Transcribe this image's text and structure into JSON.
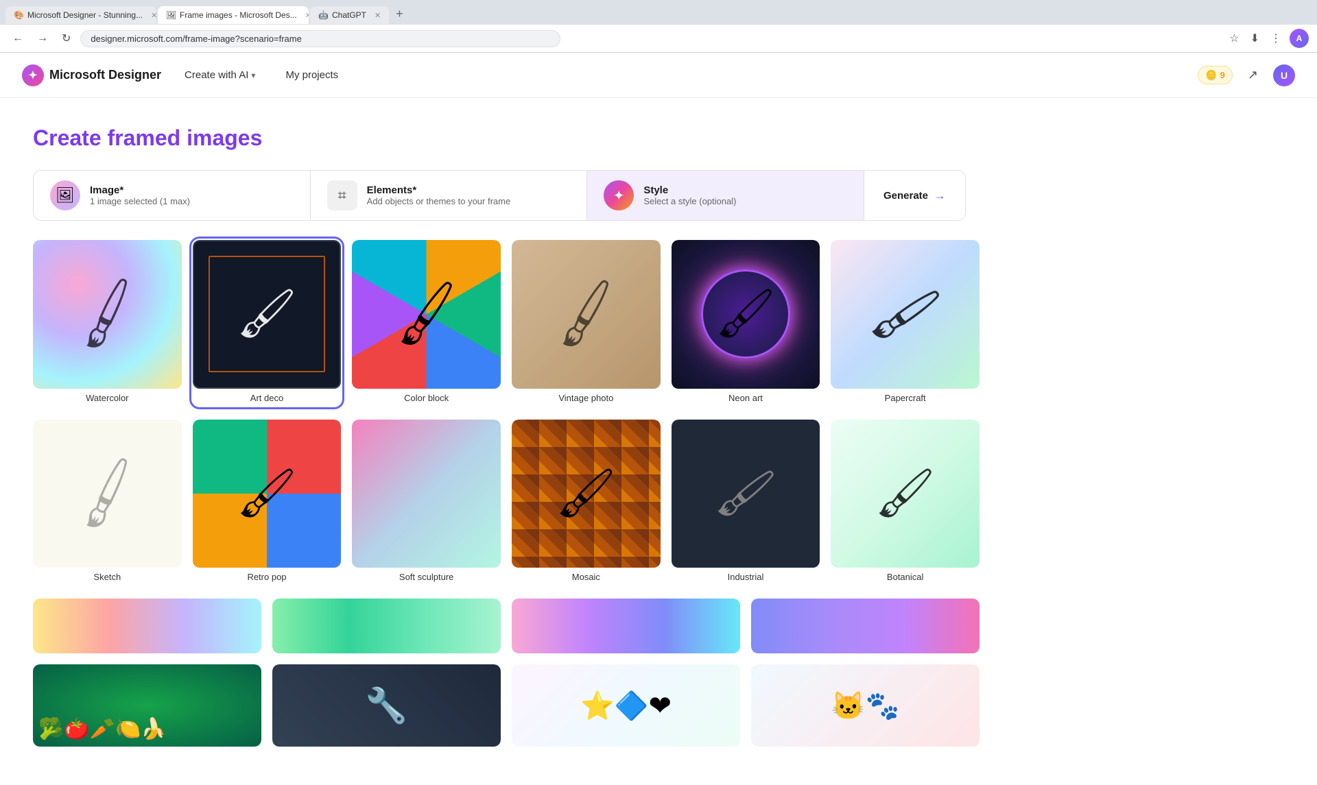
{
  "browser": {
    "tabs": [
      {
        "id": "tab1",
        "label": "Microsoft Designer - Stunning...",
        "active": false,
        "favicon": "🎨"
      },
      {
        "id": "tab2",
        "label": "Frame images - Microsoft Des...",
        "active": true,
        "favicon": "🖼"
      },
      {
        "id": "tab3",
        "label": "ChatGPT",
        "active": false,
        "favicon": "🤖"
      }
    ],
    "url": "designer.microsoft.com/frame-image?scenario=frame",
    "nav": {
      "back": "←",
      "forward": "→",
      "reload": "↻",
      "home": "⌂"
    }
  },
  "header": {
    "brand": "Microsoft Designer",
    "nav_items": [
      {
        "label": "Create with AI",
        "has_dropdown": true
      },
      {
        "label": "My projects",
        "has_dropdown": false
      }
    ],
    "coins": "9",
    "coin_icon": "🪙"
  },
  "page": {
    "title_plain": "Create ",
    "title_accent": "framed images"
  },
  "options_bar": {
    "image_section": {
      "label": "Image*",
      "sublabel": "1 image selected (1 max)"
    },
    "elements_section": {
      "label": "Elements*",
      "sublabel": "Add objects or themes to your frame"
    },
    "style_section": {
      "label": "Style",
      "sublabel": "Select a style (optional)",
      "active": true
    },
    "generate_btn": "Generate"
  },
  "styles": {
    "row1": [
      {
        "id": "watercolor",
        "label": "Watercolor",
        "selected": false
      },
      {
        "id": "artdeco",
        "label": "Art deco",
        "selected": true
      },
      {
        "id": "colorblock",
        "label": "Color block",
        "selected": false
      },
      {
        "id": "vintage",
        "label": "Vintage photo",
        "selected": false
      },
      {
        "id": "neon",
        "label": "Neon art",
        "selected": false
      },
      {
        "id": "papercraft",
        "label": "Papercraft",
        "selected": false
      }
    ],
    "row2": [
      {
        "id": "sketch",
        "label": "Sketch",
        "selected": false
      },
      {
        "id": "retro",
        "label": "Retro pop",
        "selected": false
      },
      {
        "id": "soft",
        "label": "Soft sculpture",
        "selected": false
      },
      {
        "id": "mosaic",
        "label": "Mosaic",
        "selected": false
      },
      {
        "id": "industrial",
        "label": "Industrial",
        "selected": false
      },
      {
        "id": "botanical",
        "label": "Botanical",
        "selected": false
      }
    ]
  },
  "banners": {
    "row1": [
      {
        "id": "b1",
        "color": "#fde68a"
      },
      {
        "id": "b2",
        "color": "#86efac"
      },
      {
        "id": "b3",
        "color": "#f9a8d4"
      },
      {
        "id": "b4",
        "color": "#818cf8"
      }
    ],
    "row2": [
      {
        "id": "c1",
        "color": "#16a34a"
      },
      {
        "id": "c2",
        "color": "#334155"
      },
      {
        "id": "c3",
        "color": "#fdf4ff"
      },
      {
        "id": "c4",
        "color": "#f0f9ff"
      }
    ]
  }
}
